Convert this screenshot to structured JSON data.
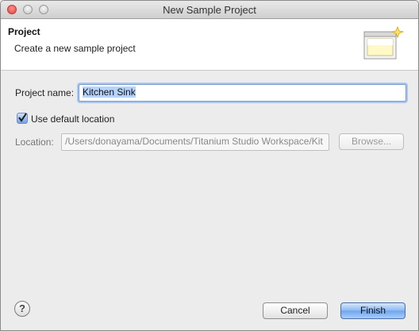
{
  "window": {
    "title": "New Sample Project"
  },
  "banner": {
    "title": "Project",
    "description": "Create a new sample project",
    "icon": "wizard-banner-icon"
  },
  "form": {
    "project_name_label": "Project name:",
    "project_name_value": "Kitchen Sink",
    "use_default_location_label": "Use default location",
    "use_default_location_checked": true,
    "location_label": "Location:",
    "location_value": "/Users/donayama/Documents/Titanium Studio Workspace/Kit",
    "browse_label": "Browse..."
  },
  "footer": {
    "help_label": "?",
    "cancel_label": "Cancel",
    "finish_label": "Finish"
  },
  "colors": {
    "accent": "#6ea5ef",
    "focus_ring": "#a9c7ee"
  }
}
